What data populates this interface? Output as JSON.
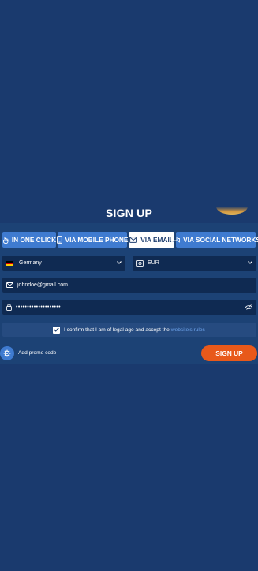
{
  "header": {
    "title": "SIGN UP"
  },
  "tabs": [
    {
      "label": "IN ONE CLICK",
      "icon": "hand-click-icon",
      "active": false
    },
    {
      "label": "VIA MOBILE PHONE",
      "icon": "mobile-phone-icon",
      "active": false
    },
    {
      "label": "VIA EMAIL",
      "icon": "envelope-icon",
      "active": true
    },
    {
      "label": "VIA SOCIAL NETWORKS",
      "icon": "chat-bubbles-icon",
      "active": false
    }
  ],
  "form": {
    "country": {
      "value": "Germany",
      "flag": "germany-flag"
    },
    "currency": {
      "value": "EUR",
      "icon": "currency-icon"
    },
    "email": {
      "value": "johndoe@gmail.com",
      "icon": "envelope-icon"
    },
    "password": {
      "value": "••••••••••••••••••••",
      "icon": "lock-icon",
      "toggle_icon": "eye-off-icon"
    },
    "confirm": {
      "checked": true,
      "text": "I confirm that I am of legal age and accept the",
      "link": "website's rules"
    }
  },
  "promo": {
    "label": "Add promo code",
    "icon": "gear-icon"
  },
  "submit": {
    "label": "SIGN UP"
  },
  "colors": {
    "background": "#1a3a6e",
    "tab": "#3f7bd0",
    "field": "#0f2a52",
    "accent": "#e8591a",
    "link": "#6fa6ee"
  }
}
